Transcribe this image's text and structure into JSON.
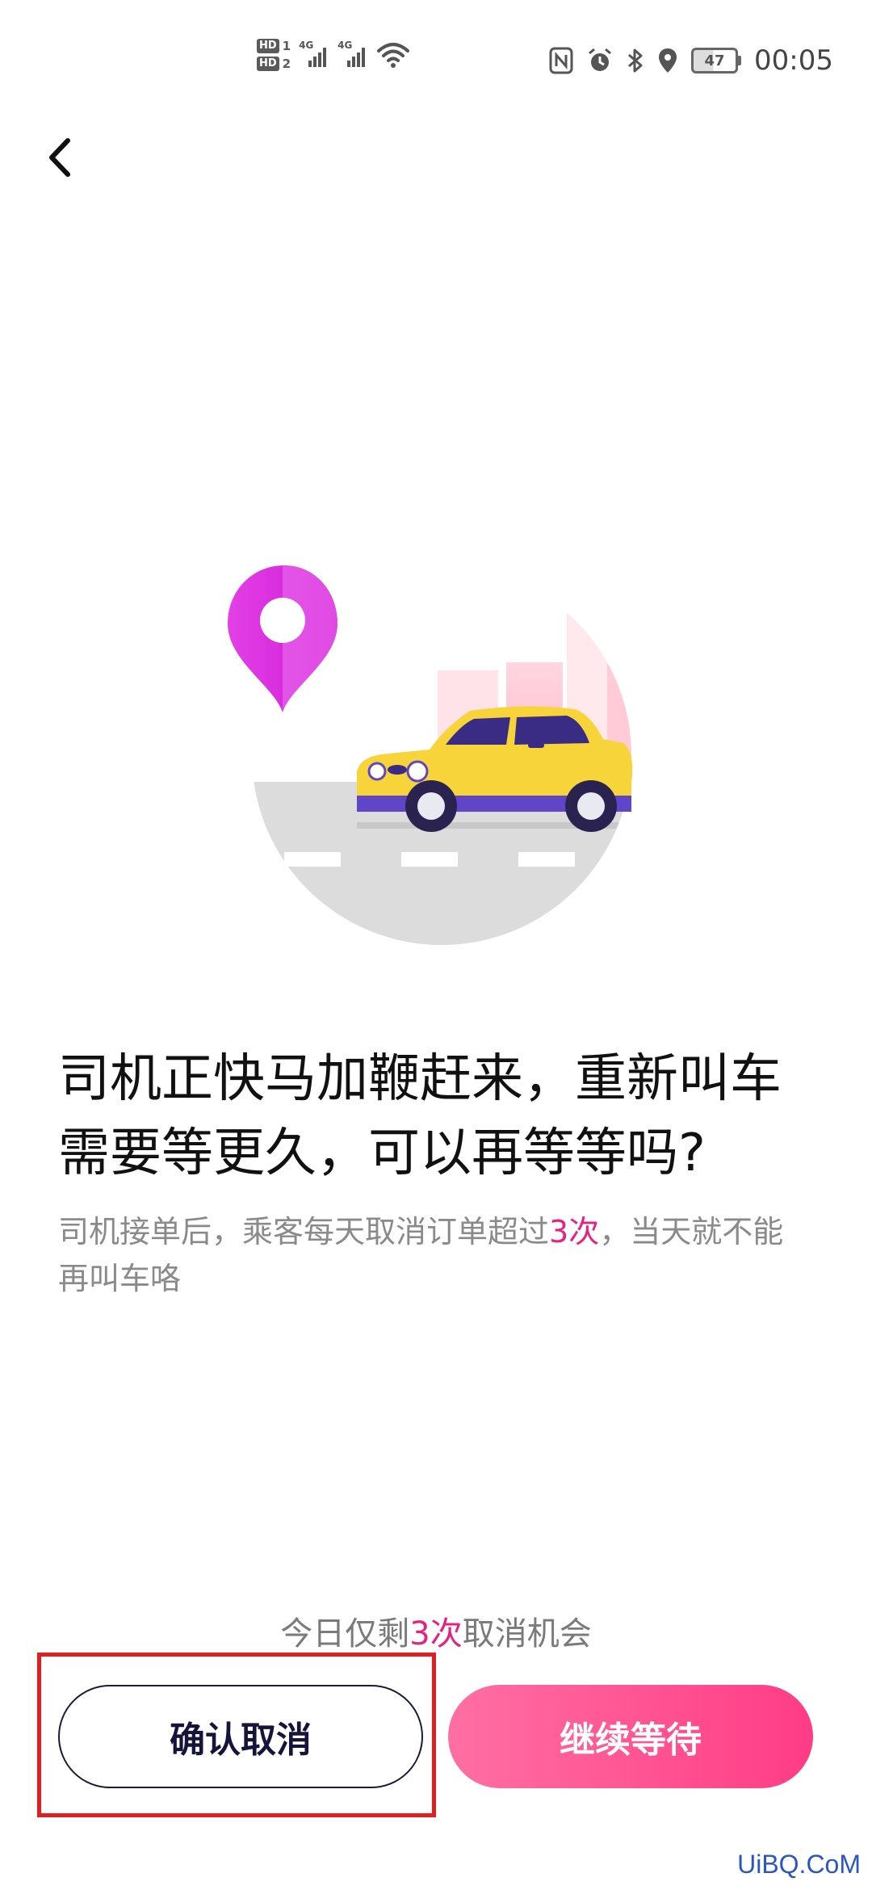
{
  "status_bar": {
    "sim1_label": "HD",
    "sim1_num": "1",
    "sim2_label": "HD",
    "sim2_num": "2",
    "network1": "4G",
    "network2": "4G",
    "battery_level": "47",
    "time": "00:05",
    "icons": [
      "nfc-icon",
      "alarm-icon",
      "bluetooth-icon",
      "location-icon"
    ]
  },
  "nav": {
    "back_icon": "chevron-left-icon"
  },
  "colors": {
    "accent": "#e8207f",
    "primary_button": "#ff4c8f",
    "highlight_frame": "#e02020"
  },
  "content": {
    "headline": "司机正快马加鞭赶来，重新叫车需要等更久，可以再等等吗?",
    "sub_prefix": "司机接单后，乘客每天取消订单超过",
    "sub_highlight": "3次",
    "sub_suffix": "，当天就不能再叫车咯"
  },
  "footer": {
    "remaining_prefix": "今日仅剩",
    "remaining_highlight": "3次",
    "remaining_suffix": "取消机会",
    "confirm_label": "确认取消",
    "wait_label": "继续等待"
  },
  "watermark": "UiBQ.CoM"
}
